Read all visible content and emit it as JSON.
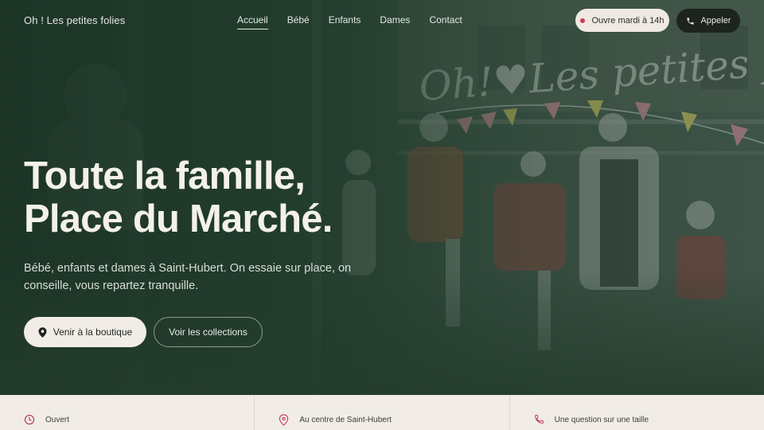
{
  "brand": "Oh ! Les petites folies",
  "nav": {
    "items": [
      "Accueil",
      "Bébé",
      "Enfants",
      "Dames",
      "Contact"
    ],
    "active": "Accueil"
  },
  "status": {
    "label": "Ouvre mardi à 14h",
    "dot_color": "#d23a5a"
  },
  "call": {
    "label": "Appeler",
    "icon": "phone-icon"
  },
  "hero": {
    "headline_line1": "Toute la famille,",
    "headline_line2": "Place du Marché.",
    "lead": "Bébé, enfants et dames à Saint-Hubert. On essaie sur place, on conseille, vous repartez tranquille.",
    "primary_cta": "Venir à la boutique",
    "secondary_cta": "Voir les collections",
    "window_lettering": "Oh!♥Les petites folies"
  },
  "info": [
    {
      "label": "Ouvert",
      "icon": "clock-icon"
    },
    {
      "label": "Au centre de Saint-Hubert",
      "icon": "map-pin-icon"
    },
    {
      "label": "Une question sur une taille",
      "icon": "phone-icon"
    }
  ],
  "colors": {
    "hero_green": "#2a4435",
    "accent_rose": "#d23a5a",
    "cream": "#f1ede6",
    "dark_button": "#1d231f"
  }
}
